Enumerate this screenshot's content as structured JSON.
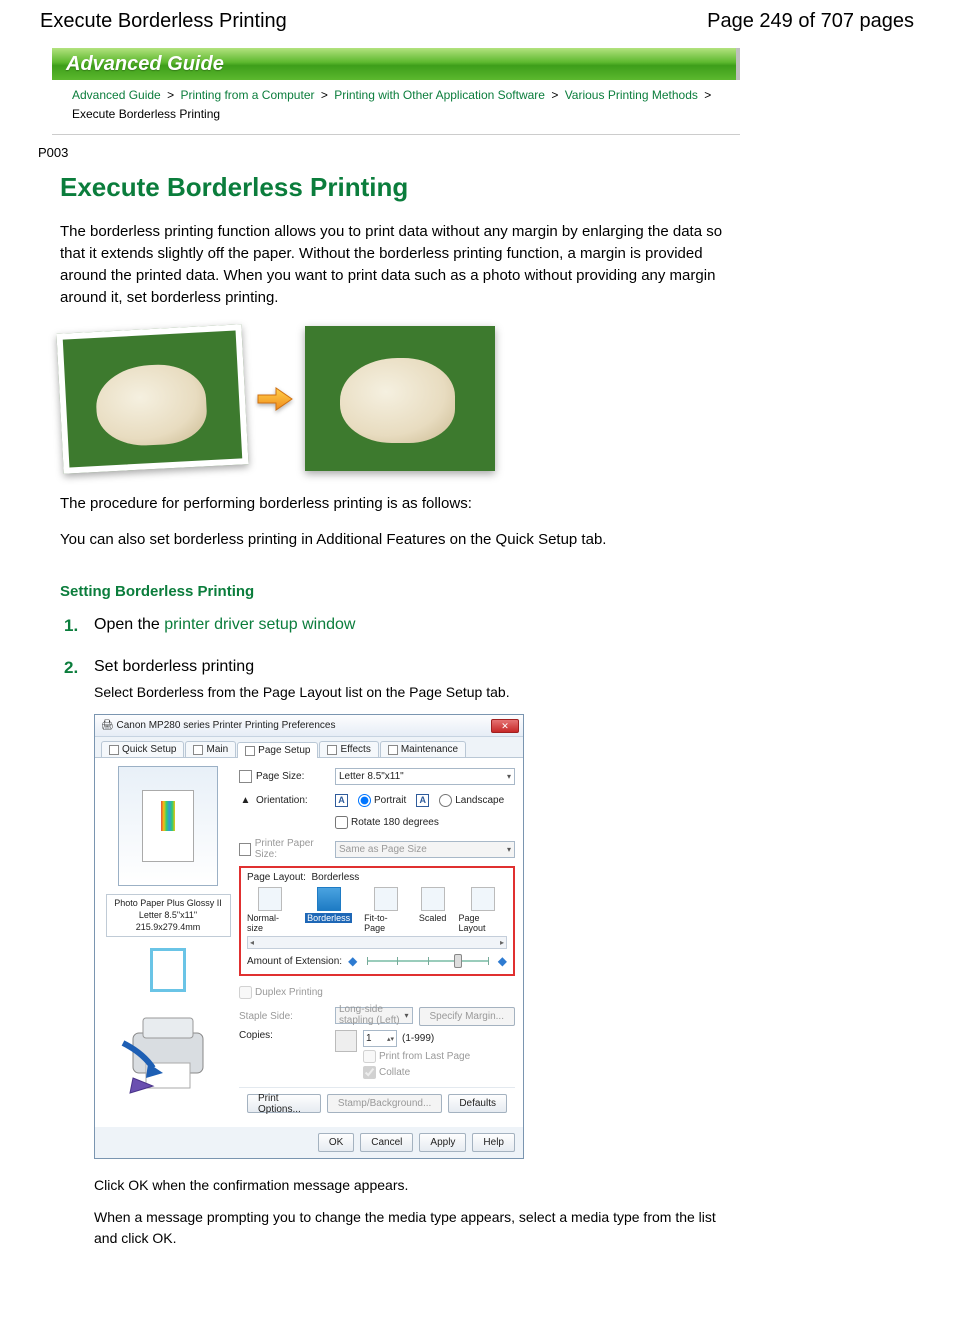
{
  "header": {
    "title": "Execute Borderless Printing",
    "page_indicator": "Page 249 of 707 pages"
  },
  "banner": "Advanced Guide",
  "breadcrumb": {
    "items": [
      {
        "label": "Advanced Guide",
        "link": true
      },
      {
        "label": "Printing from a Computer",
        "link": true
      },
      {
        "label": "Printing with Other Application Software",
        "link": true
      },
      {
        "label": "Various Printing Methods",
        "link": true
      },
      {
        "label": "Execute Borderless Printing",
        "link": false
      }
    ],
    "separator": ">"
  },
  "doc_id": "P003",
  "main_heading": "Execute Borderless Printing",
  "intro": "The borderless printing function allows you to print data without any margin by enlarging the data so that it extends slightly off the paper. Without the borderless printing function, a margin is provided around the printed data. When you want to print data such as a photo without providing any margin around it, set borderless printing.",
  "procedure_line": "The procedure for performing borderless printing is as follows:",
  "quick_setup_note": "You can also set borderless printing in Additional Features on the Quick Setup tab.",
  "section_heading": "Setting Borderless Printing",
  "steps": {
    "s1": {
      "num": "1.",
      "prefix": "Open the ",
      "link": "printer driver setup window"
    },
    "s2": {
      "num": "2.",
      "title": "Set borderless printing",
      "desc": "Select Borderless from the Page Layout list on the Page Setup tab.",
      "after1": "Click OK when the confirmation message appears.",
      "after2": "When a message prompting you to change the media type appears, select a media type from the list and click OK."
    }
  },
  "dialog": {
    "title": "Canon MP280 series Printer Printing Preferences",
    "close": "✕",
    "tabs": {
      "quick": "Quick Setup",
      "main": "Main",
      "page_setup": "Page Setup",
      "effects": "Effects",
      "maintenance": "Maintenance"
    },
    "media_info": {
      "line1": "Photo Paper Plus Glossy II",
      "line2": "Letter 8.5\"x11\" 215.9x279.4mm"
    },
    "page_size": {
      "label": "Page Size:",
      "value": "Letter 8.5\"x11\""
    },
    "orientation": {
      "label": "Orientation:",
      "portrait": "Portrait",
      "landscape": "Landscape",
      "rotate": "Rotate 180 degrees"
    },
    "printer_paper": {
      "label": "Printer Paper Size:",
      "value": "Same as Page Size"
    },
    "page_layout": {
      "label": "Page Layout:",
      "value": "Borderless",
      "opts": {
        "normal": "Normal-size",
        "borderless": "Borderless",
        "fit": "Fit-to-Page",
        "scaled": "Scaled",
        "layout": "Page Layout"
      }
    },
    "extension_label": "Amount of Extension:",
    "duplex": "Duplex Printing",
    "staple": {
      "label": "Staple Side:",
      "value": "Long-side stapling (Left)",
      "btn": "Specify Margin..."
    },
    "copies": {
      "label": "Copies:",
      "value": "1",
      "range": "(1-999)",
      "print_last": "Print from Last Page",
      "collate": "Collate"
    },
    "mid_buttons": {
      "print_options": "Print Options...",
      "stamp": "Stamp/Background...",
      "defaults": "Defaults"
    },
    "bottom_buttons": {
      "ok": "OK",
      "cancel": "Cancel",
      "apply": "Apply",
      "help": "Help"
    }
  }
}
